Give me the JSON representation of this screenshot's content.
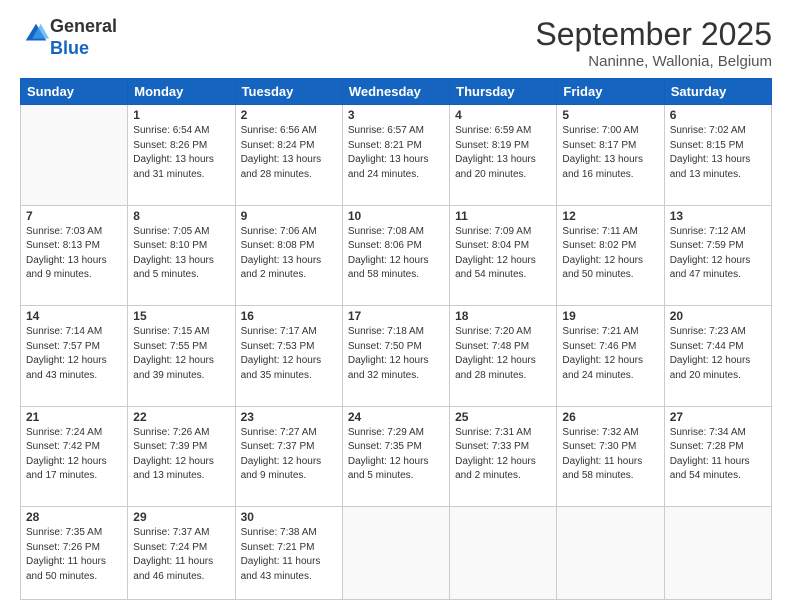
{
  "logo": {
    "general": "General",
    "blue": "Blue"
  },
  "header": {
    "title": "September 2025",
    "location": "Naninne, Wallonia, Belgium"
  },
  "weekdays": [
    "Sunday",
    "Monday",
    "Tuesday",
    "Wednesday",
    "Thursday",
    "Friday",
    "Saturday"
  ],
  "weeks": [
    [
      {
        "day": "",
        "info": ""
      },
      {
        "day": "1",
        "info": "Sunrise: 6:54 AM\nSunset: 8:26 PM\nDaylight: 13 hours\nand 31 minutes."
      },
      {
        "day": "2",
        "info": "Sunrise: 6:56 AM\nSunset: 8:24 PM\nDaylight: 13 hours\nand 28 minutes."
      },
      {
        "day": "3",
        "info": "Sunrise: 6:57 AM\nSunset: 8:21 PM\nDaylight: 13 hours\nand 24 minutes."
      },
      {
        "day": "4",
        "info": "Sunrise: 6:59 AM\nSunset: 8:19 PM\nDaylight: 13 hours\nand 20 minutes."
      },
      {
        "day": "5",
        "info": "Sunrise: 7:00 AM\nSunset: 8:17 PM\nDaylight: 13 hours\nand 16 minutes."
      },
      {
        "day": "6",
        "info": "Sunrise: 7:02 AM\nSunset: 8:15 PM\nDaylight: 13 hours\nand 13 minutes."
      }
    ],
    [
      {
        "day": "7",
        "info": "Sunrise: 7:03 AM\nSunset: 8:13 PM\nDaylight: 13 hours\nand 9 minutes."
      },
      {
        "day": "8",
        "info": "Sunrise: 7:05 AM\nSunset: 8:10 PM\nDaylight: 13 hours\nand 5 minutes."
      },
      {
        "day": "9",
        "info": "Sunrise: 7:06 AM\nSunset: 8:08 PM\nDaylight: 13 hours\nand 2 minutes."
      },
      {
        "day": "10",
        "info": "Sunrise: 7:08 AM\nSunset: 8:06 PM\nDaylight: 12 hours\nand 58 minutes."
      },
      {
        "day": "11",
        "info": "Sunrise: 7:09 AM\nSunset: 8:04 PM\nDaylight: 12 hours\nand 54 minutes."
      },
      {
        "day": "12",
        "info": "Sunrise: 7:11 AM\nSunset: 8:02 PM\nDaylight: 12 hours\nand 50 minutes."
      },
      {
        "day": "13",
        "info": "Sunrise: 7:12 AM\nSunset: 7:59 PM\nDaylight: 12 hours\nand 47 minutes."
      }
    ],
    [
      {
        "day": "14",
        "info": "Sunrise: 7:14 AM\nSunset: 7:57 PM\nDaylight: 12 hours\nand 43 minutes."
      },
      {
        "day": "15",
        "info": "Sunrise: 7:15 AM\nSunset: 7:55 PM\nDaylight: 12 hours\nand 39 minutes."
      },
      {
        "day": "16",
        "info": "Sunrise: 7:17 AM\nSunset: 7:53 PM\nDaylight: 12 hours\nand 35 minutes."
      },
      {
        "day": "17",
        "info": "Sunrise: 7:18 AM\nSunset: 7:50 PM\nDaylight: 12 hours\nand 32 minutes."
      },
      {
        "day": "18",
        "info": "Sunrise: 7:20 AM\nSunset: 7:48 PM\nDaylight: 12 hours\nand 28 minutes."
      },
      {
        "day": "19",
        "info": "Sunrise: 7:21 AM\nSunset: 7:46 PM\nDaylight: 12 hours\nand 24 minutes."
      },
      {
        "day": "20",
        "info": "Sunrise: 7:23 AM\nSunset: 7:44 PM\nDaylight: 12 hours\nand 20 minutes."
      }
    ],
    [
      {
        "day": "21",
        "info": "Sunrise: 7:24 AM\nSunset: 7:42 PM\nDaylight: 12 hours\nand 17 minutes."
      },
      {
        "day": "22",
        "info": "Sunrise: 7:26 AM\nSunset: 7:39 PM\nDaylight: 12 hours\nand 13 minutes."
      },
      {
        "day": "23",
        "info": "Sunrise: 7:27 AM\nSunset: 7:37 PM\nDaylight: 12 hours\nand 9 minutes."
      },
      {
        "day": "24",
        "info": "Sunrise: 7:29 AM\nSunset: 7:35 PM\nDaylight: 12 hours\nand 5 minutes."
      },
      {
        "day": "25",
        "info": "Sunrise: 7:31 AM\nSunset: 7:33 PM\nDaylight: 12 hours\nand 2 minutes."
      },
      {
        "day": "26",
        "info": "Sunrise: 7:32 AM\nSunset: 7:30 PM\nDaylight: 11 hours\nand 58 minutes."
      },
      {
        "day": "27",
        "info": "Sunrise: 7:34 AM\nSunset: 7:28 PM\nDaylight: 11 hours\nand 54 minutes."
      }
    ],
    [
      {
        "day": "28",
        "info": "Sunrise: 7:35 AM\nSunset: 7:26 PM\nDaylight: 11 hours\nand 50 minutes."
      },
      {
        "day": "29",
        "info": "Sunrise: 7:37 AM\nSunset: 7:24 PM\nDaylight: 11 hours\nand 46 minutes."
      },
      {
        "day": "30",
        "info": "Sunrise: 7:38 AM\nSunset: 7:21 PM\nDaylight: 11 hours\nand 43 minutes."
      },
      {
        "day": "",
        "info": ""
      },
      {
        "day": "",
        "info": ""
      },
      {
        "day": "",
        "info": ""
      },
      {
        "day": "",
        "info": ""
      }
    ]
  ]
}
